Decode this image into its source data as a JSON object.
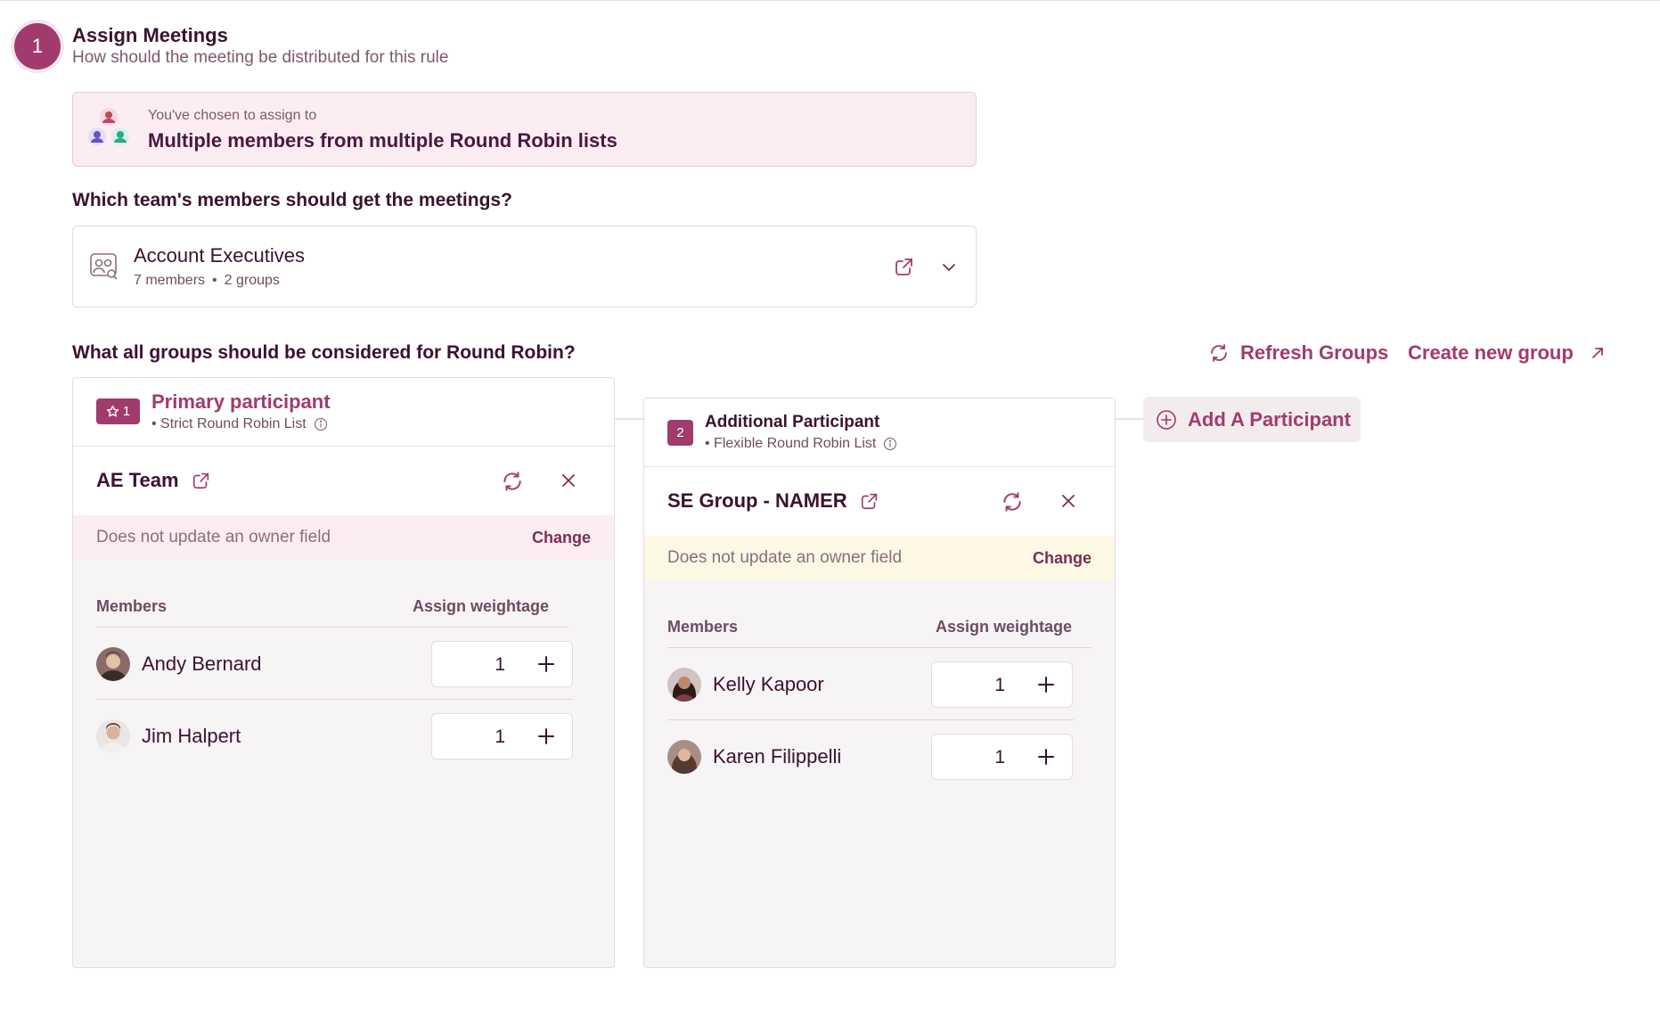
{
  "step": {
    "number": "1",
    "title": "Assign Meetings",
    "subtitle": "How should the meeting be distributed for this rule"
  },
  "chosen": {
    "small": "You've chosen to assign to",
    "big": "Multiple members from multiple Round Robin lists"
  },
  "team_question": "Which team's members should get the meetings?",
  "team_select": {
    "name": "Account Executives",
    "members": "7 members",
    "separator": "•",
    "groups": "2 groups"
  },
  "groups_question": "What all groups should be considered for Round Robin?",
  "actions": {
    "refresh": "Refresh Groups",
    "create": "Create new group",
    "add_participant": "Add A Participant"
  },
  "participants": [
    {
      "badge": "1",
      "title": "Primary participant",
      "list_type": "• Strict Round Robin List",
      "group": "AE Team",
      "owner_text": "Does not update an owner field",
      "change": "Change",
      "col_members": "Members",
      "col_weight": "Assign weightage",
      "members": [
        {
          "name": "Andy Bernard",
          "weight": "1"
        },
        {
          "name": "Jim Halpert",
          "weight": "1"
        }
      ]
    },
    {
      "badge": "2",
      "title": "Additional Participant",
      "list_type": "• Flexible Round Robin List",
      "group": "SE Group - NAMER",
      "owner_text": "Does not update an owner field",
      "change": "Change",
      "col_members": "Members",
      "col_weight": "Assign weightage",
      "members": [
        {
          "name": "Kelly Kapoor",
          "weight": "1"
        },
        {
          "name": "Karen Filippelli",
          "weight": "1"
        }
      ]
    }
  ],
  "colors": {
    "accent": "#a13b6e",
    "text": "#3b1230",
    "pink_bg": "#fcedf3",
    "yellow_bg": "#fdf8e4"
  },
  "icons": [
    "users-group-icon",
    "team-icon",
    "external-link-icon",
    "chevron-down-icon",
    "refresh-icon",
    "arrow-up-right-icon",
    "star-icon",
    "info-icon",
    "close-icon",
    "plus-icon",
    "plus-circle-icon"
  ]
}
